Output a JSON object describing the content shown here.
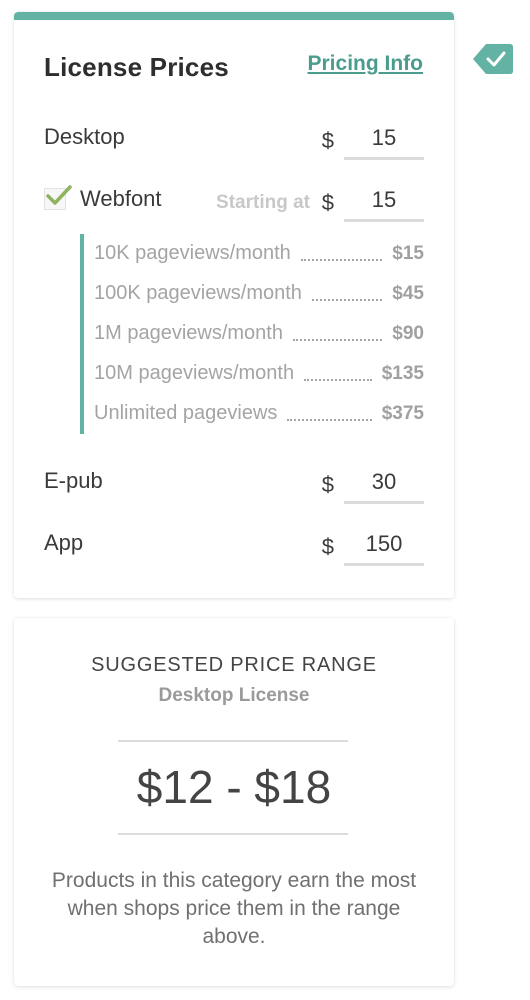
{
  "license": {
    "title": "License Prices",
    "pricing_link": "Pricing Info",
    "currency": "$",
    "desktop": {
      "label": "Desktop",
      "value": "15"
    },
    "webfont": {
      "label": "Webfont",
      "checked": true,
      "starting_label": "Starting at",
      "value": "15"
    },
    "tiers": [
      {
        "label": "10K pageviews/month",
        "price": "$15"
      },
      {
        "label": "100K pageviews/month",
        "price": "$45"
      },
      {
        "label": "1M pageviews/month",
        "price": "$90"
      },
      {
        "label": "10M pageviews/month",
        "price": "$135"
      },
      {
        "label": "Unlimited pageviews",
        "price": "$375"
      }
    ],
    "epub": {
      "label": "E-pub",
      "value": "30"
    },
    "app": {
      "label": "App",
      "value": "150"
    }
  },
  "suggested": {
    "heading": "SUGGESTED PRICE RANGE",
    "subheading": "Desktop License",
    "range": "$12 - $18",
    "note": "Products in this category earn the most when shops price them in the range above."
  },
  "colors": {
    "accent": "#63b3a4",
    "link": "#4a9d8d",
    "check": "#8fb35f"
  },
  "icons": {
    "side_badge": "check-badge-icon",
    "checkbox_mark": "checkmark-icon"
  }
}
